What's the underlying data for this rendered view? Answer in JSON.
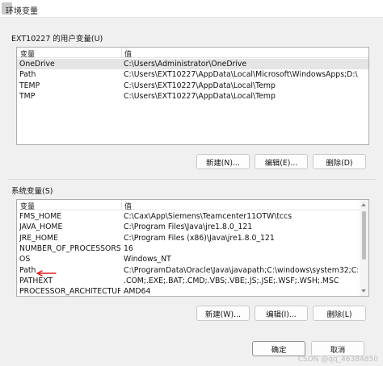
{
  "window": {
    "title": "环境变量"
  },
  "user_section": {
    "label": "EXT10227 的用户变量(U)",
    "columns": {
      "var": "变量",
      "val": "值"
    },
    "rows": [
      {
        "var": "OneDrive",
        "val": "C:\\Users\\Administrator\\OneDrive",
        "selected": true
      },
      {
        "var": "Path",
        "val": "C:\\Users\\EXT10227\\AppData\\Local\\Microsoft\\WindowsApps;D:\\do..."
      },
      {
        "var": "TEMP",
        "val": "C:\\Users\\EXT10227\\AppData\\Local\\Temp"
      },
      {
        "var": "TMP",
        "val": "C:\\Users\\EXT10227\\AppData\\Local\\Temp"
      }
    ],
    "buttons": {
      "new": "新建(N)...",
      "edit": "编辑(E)...",
      "delete": "删除(D)"
    }
  },
  "system_section": {
    "label": "系统变量(S)",
    "columns": {
      "var": "变量",
      "val": "值"
    },
    "rows": [
      {
        "var": "FMS_HOME",
        "val": "C:\\Cax\\App\\Siemens\\Teamcenter11OTW\\tccs"
      },
      {
        "var": "JAVA_HOME",
        "val": "C:\\Program Files\\Java\\jre1.8.0_121"
      },
      {
        "var": "JRE_HOME",
        "val": "C:\\Program Files (x86)\\Java\\jre1.8.0_121"
      },
      {
        "var": "NUMBER_OF_PROCESSORS",
        "val": "16"
      },
      {
        "var": "OS",
        "val": "Windows_NT"
      },
      {
        "var": "Path",
        "val": "C:\\ProgramData\\Oracle\\Java\\javapath;C:\\windows\\system32;C:\\wi..."
      },
      {
        "var": "PATHEXT",
        "val": ".COM;.EXE;.BAT;.CMD;.VBS;.VBE;.JS;.JSE;.WSF;.WSH;.MSC"
      },
      {
        "var": "PROCESSOR_ARCHITECTURE",
        "val": "AMD64"
      }
    ],
    "buttons": {
      "new": "新建(W)...",
      "edit": "编辑(I)...",
      "delete": "删除(L)"
    }
  },
  "footer": {
    "ok": "确定",
    "cancel": "取消",
    "watermark": "CSDN @qq_46384850"
  },
  "colors": {
    "annotation_arrow": "#e02020",
    "selection": "#e5e5e5"
  }
}
